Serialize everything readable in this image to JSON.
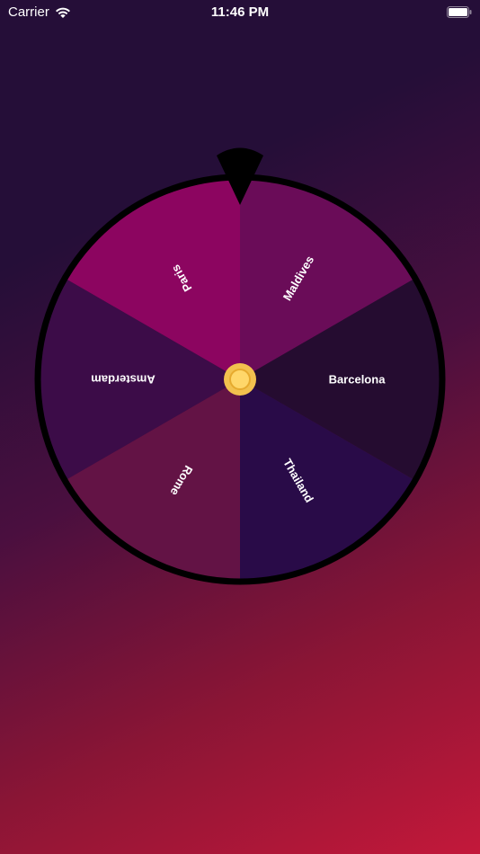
{
  "status_bar": {
    "carrier": "Carrier",
    "time": "11:46 PM",
    "wifi_icon": "wifi-icon",
    "battery_icon": "battery-full-icon"
  },
  "wheel": {
    "pointer_icon": "pointer-icon",
    "center_icon": "coin-icon",
    "rim_color": "#000000",
    "center_color": "#f2c14e",
    "segments": [
      {
        "label": "Maldives",
        "color": "#6a0c58"
      },
      {
        "label": "Barcelona",
        "color": "#250c30"
      },
      {
        "label": "Thailand",
        "color": "#290b48"
      },
      {
        "label": "Rome",
        "color": "#631345"
      },
      {
        "label": "Amsterdam",
        "color": "#3c0c48"
      },
      {
        "label": "Paris",
        "color": "#8c0560"
      }
    ]
  }
}
